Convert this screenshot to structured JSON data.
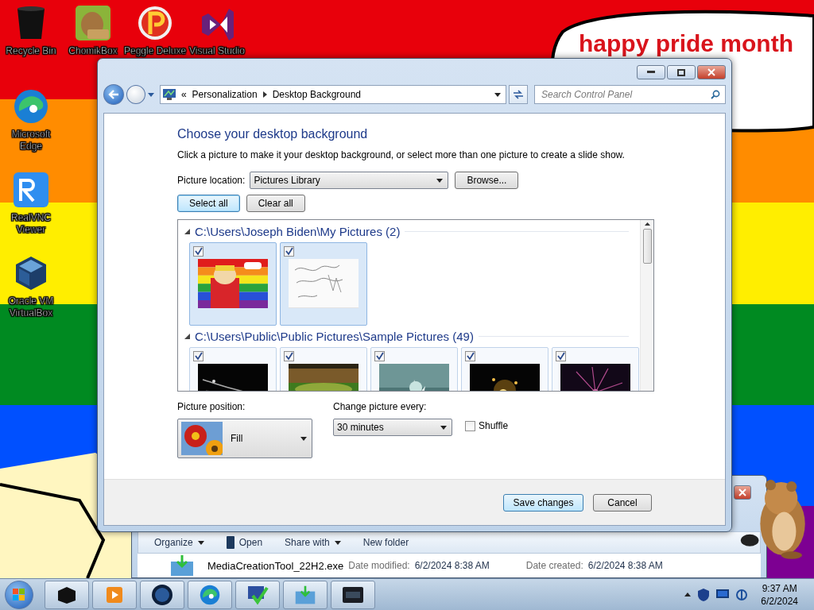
{
  "wallpaper": {
    "caption": "happy pride month"
  },
  "desktop_icons": [
    {
      "label": "Recycle Bin"
    },
    {
      "label": "ChomikBox"
    },
    {
      "label": "Peggle Deluxe"
    },
    {
      "label": "Visual Studio"
    },
    {
      "label": "Microsoft Edge"
    },
    {
      "label": "RealVNC Viewer"
    },
    {
      "label": "Oracle VM VirtualBox"
    }
  ],
  "explorer": {
    "toolbar": [
      {
        "label": "Organize",
        "dropdown": true
      },
      {
        "label": "Open",
        "dropdown": false
      },
      {
        "label": "Share with",
        "dropdown": true
      },
      {
        "label": "New folder",
        "dropdown": false
      }
    ],
    "file": {
      "name": "MediaCreationTool_22H2.exe",
      "modified_label": "Date modified:",
      "modified": "6/2/2024 8:38 AM",
      "created_label": "Date created:",
      "created": "6/2/2024 8:38 AM"
    }
  },
  "window": {
    "overflow": "«",
    "breadcrumb": [
      "Personalization",
      "Desktop Background"
    ],
    "search": {
      "placeholder": "Search Control Panel"
    },
    "heading": "Choose your desktop background",
    "description": "Click a picture to make it your desktop background, or select more than one picture to create a slide show.",
    "picture_location": {
      "label": "Picture location:",
      "value": "Pictures Library"
    },
    "browse": "Browse...",
    "select_all": "Select all",
    "clear_all": "Clear all",
    "groups": [
      {
        "title": "C:\\Users\\Joseph Biden\\My Pictures (2)",
        "expanded": true,
        "pictures": [
          {
            "checked": true,
            "selected": true
          },
          {
            "checked": true,
            "selected": true
          }
        ]
      },
      {
        "title": "C:\\Users\\Public\\Public Pictures\\Sample Pictures (49)",
        "expanded": true,
        "pictures": [
          {
            "checked": true,
            "selected": false
          },
          {
            "checked": true,
            "selected": false
          },
          {
            "checked": true,
            "selected": false
          },
          {
            "checked": true,
            "selected": false
          },
          {
            "checked": true,
            "selected": false
          }
        ]
      }
    ],
    "position": {
      "label": "Picture position:",
      "value": "Fill"
    },
    "interval": {
      "label": "Change picture every:",
      "value": "30 minutes"
    },
    "shuffle": {
      "label": "Shuffle",
      "checked": false
    },
    "buttons": [
      {
        "label": "Save changes",
        "default": true
      },
      {
        "label": "Cancel",
        "default": false
      }
    ]
  },
  "clock": {
    "time": "9:37 AM",
    "date": "6/2/2024"
  }
}
